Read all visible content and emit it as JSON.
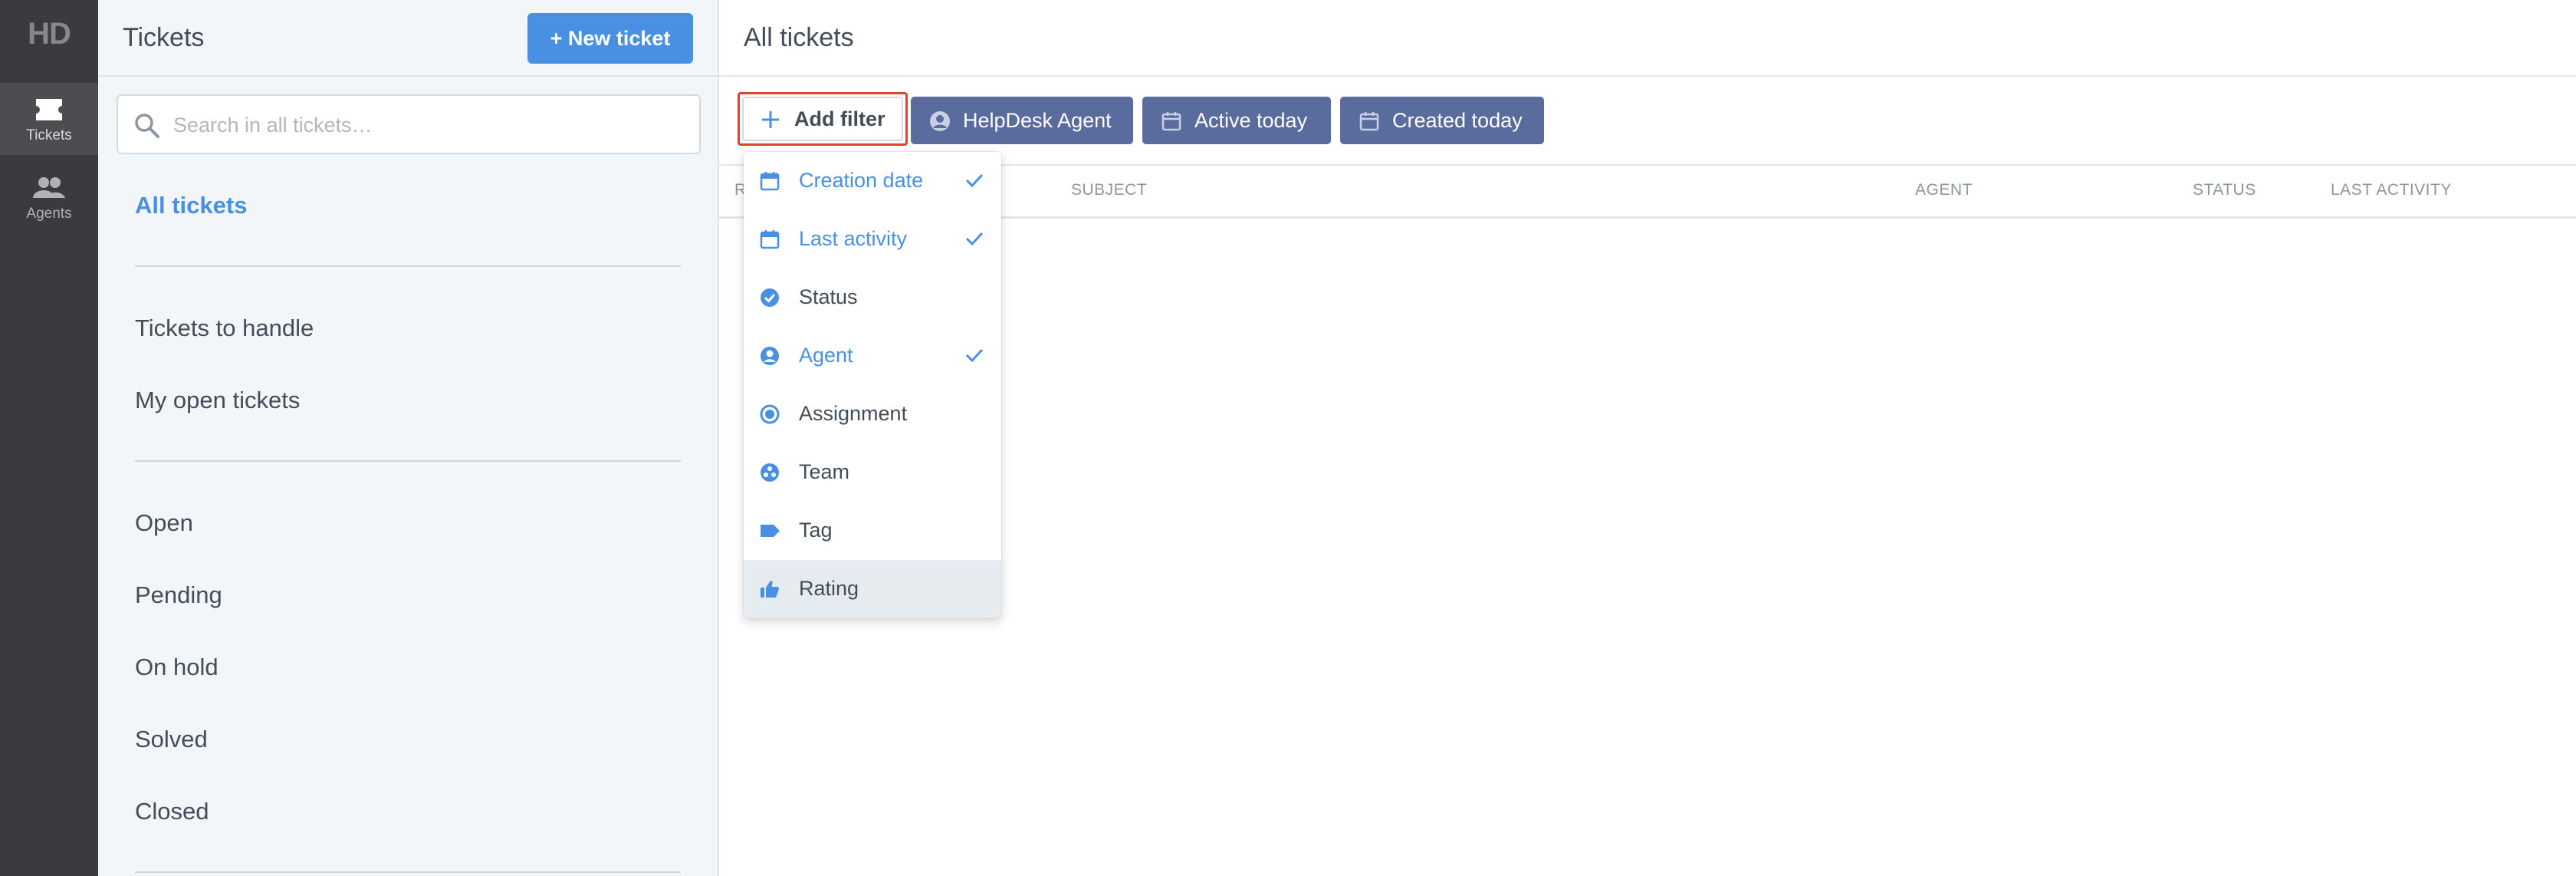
{
  "rail": {
    "logo": "HD",
    "items": [
      {
        "label": "Tickets",
        "icon": "tickets-icon",
        "active": true
      },
      {
        "label": "Agents",
        "icon": "agents-icon",
        "active": false
      }
    ]
  },
  "sidebar": {
    "title": "Tickets",
    "new_ticket_label": "+ New ticket",
    "search_placeholder": "Search in all tickets…",
    "all_tickets": "All tickets",
    "group1": [
      "Tickets to handle",
      "My open tickets"
    ],
    "group2": [
      "Open",
      "Pending",
      "On hold",
      "Solved",
      "Closed"
    ]
  },
  "main": {
    "title": "All tickets",
    "add_filter_label": "Add filter",
    "chips": [
      {
        "label": "HelpDesk Agent",
        "icon": "user-circle-icon"
      },
      {
        "label": "Active today",
        "icon": "calendar-icon"
      },
      {
        "label": "Created today",
        "icon": "calendar-icon"
      }
    ],
    "columns": [
      "R",
      "SUBJECT",
      "AGENT",
      "STATUS",
      "LAST ACTIVITY"
    ]
  },
  "dropdown": {
    "items": [
      {
        "label": "Creation date",
        "icon": "calendar-icon",
        "selected": true
      },
      {
        "label": "Last activity",
        "icon": "calendar-icon",
        "selected": true
      },
      {
        "label": "Status",
        "icon": "check-circle-icon",
        "selected": false
      },
      {
        "label": "Agent",
        "icon": "user-circle-icon",
        "selected": true
      },
      {
        "label": "Assignment",
        "icon": "radio-icon",
        "selected": false
      },
      {
        "label": "Team",
        "icon": "team-icon",
        "selected": false
      },
      {
        "label": "Tag",
        "icon": "tag-icon",
        "selected": false
      },
      {
        "label": "Rating",
        "icon": "thumbs-up-icon",
        "selected": false,
        "hovered": true
      }
    ]
  },
  "colors": {
    "accent": "#4a90e2",
    "chip": "#5a6b9e",
    "rail": "#3c3a3e",
    "sidebar_bg": "#f2f6f9",
    "highlight_outline": "#d9472b"
  }
}
